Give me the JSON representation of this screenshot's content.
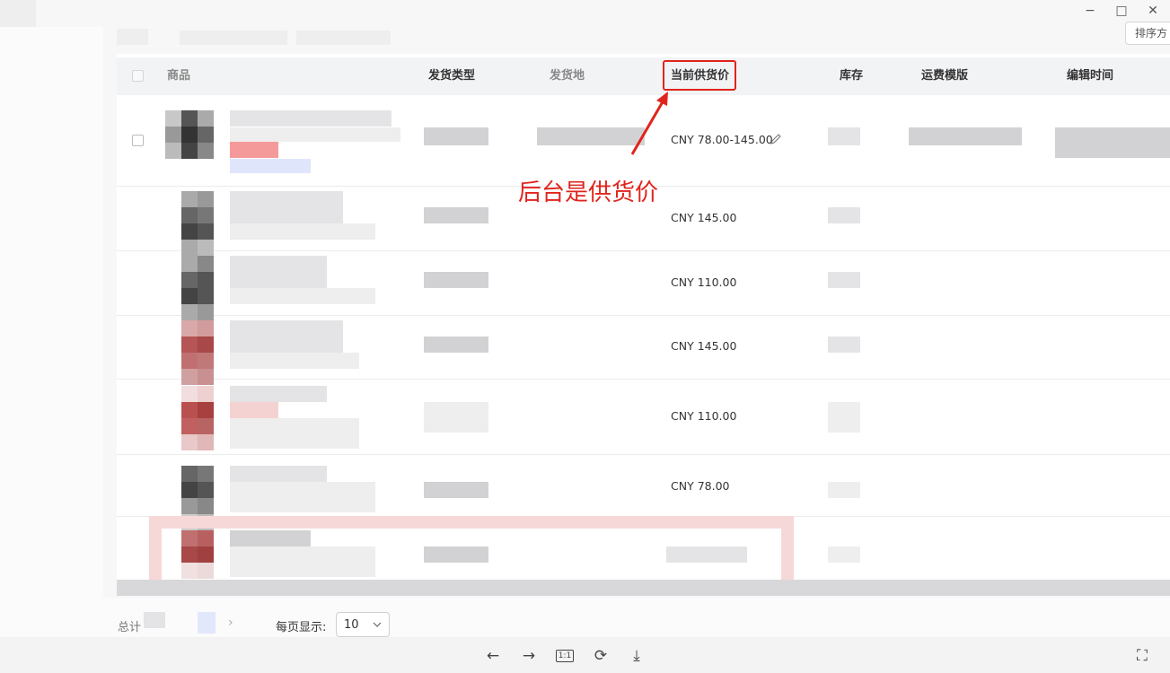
{
  "window": {
    "minimize_icon": "minimize-icon",
    "maximize_icon": "maximize-icon",
    "close_icon": "close-icon",
    "minimize_glyph": "−",
    "maximize_glyph": "□",
    "close_glyph": "✕"
  },
  "toolbar": {
    "sort_button_label": "排序方"
  },
  "table": {
    "columns": {
      "product": "商品",
      "shipping_type": "发货类型",
      "ship_from": "发货地",
      "current_supply_price": "当前供货价",
      "stock": "库存",
      "shipping_template": "运费模版",
      "edit_time": "编辑时间"
    },
    "prices": [
      "CNY  78.00-145.00",
      "CNY  145.00",
      "CNY  110.00",
      "CNY  145.00",
      "CNY  110.00",
      "CNY  78.00"
    ],
    "edit_icon": "pencil-icon"
  },
  "annotation": {
    "text": "后台是供货价",
    "color": "#e0241d"
  },
  "pagination": {
    "total_label": "总计",
    "per_page_label": "每页显示:",
    "per_page_value": "10",
    "chevron_right": "›"
  },
  "viewer_toolbar": {
    "prev_glyph": "←",
    "next_glyph": "→",
    "actual_size_label": "1:1",
    "rotate_glyph": "⟳",
    "download_glyph": "⤓",
    "fit_glyph": "⛶"
  }
}
